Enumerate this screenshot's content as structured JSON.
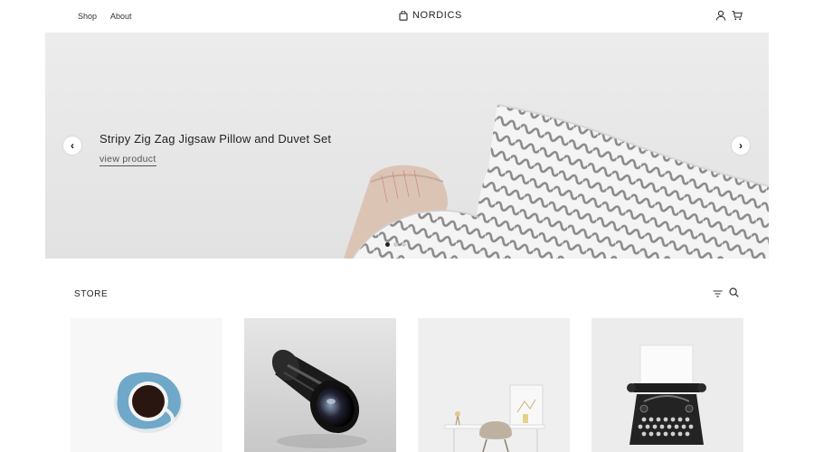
{
  "header": {
    "nav": [
      {
        "label": "Shop"
      },
      {
        "label": "About"
      }
    ],
    "brand": "NORDICS",
    "icons": [
      "bag-icon",
      "user-icon",
      "cart-icon"
    ]
  },
  "hero": {
    "title": "Stripy Zig Zag Jigsaw Pillow and Duvet Set",
    "link": "view product",
    "prev_glyph": "‹",
    "next_glyph": "›",
    "slide_count": 3,
    "active_slide": 1
  },
  "store": {
    "title": "STORE",
    "icons": [
      "filter-icon",
      "search-icon"
    ],
    "products": [
      {
        "image": "coffee-cup-image"
      },
      {
        "image": "camera-lens-image"
      },
      {
        "image": "desk-chair-image"
      },
      {
        "image": "typewriter-image"
      }
    ]
  },
  "colors": {
    "text": "#222222",
    "background": "#ffffff",
    "hero_background": "#e9e9e9",
    "cup_blue": "#6fa8c8"
  }
}
